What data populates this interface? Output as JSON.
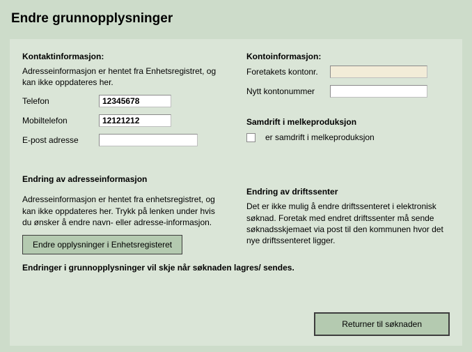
{
  "page": {
    "title": "Endre grunnopplysninger"
  },
  "contact": {
    "header": "Kontaktinformasjon:",
    "help": "Adresseinformasjon er hentet fra Enhetsregistret, og kan ikke oppdateres her.",
    "phone_label": "Telefon",
    "phone_value": "12345678",
    "mobile_label": "Mobiltelefon",
    "mobile_value": "12121212",
    "email_label": "E-post adresse",
    "email_value": ""
  },
  "account": {
    "header": "Kontoinformasjon:",
    "account_label": "Foretakets kontonr.",
    "account_value": "",
    "new_account_label": "Nytt kontonummer",
    "new_account_value": ""
  },
  "samdrift": {
    "header": "Samdrift i melkeproduksjon",
    "checkbox_label": "er samdrift i melkeproduksjon"
  },
  "address_change": {
    "header": "Endring av adresseinformasjon",
    "help": "Adresseinformasjon er hentet fra enhetsregistret, og kan ikke oppdateres her. Trykk på lenken under hvis du ønsker å endre navn- eller adresse-informasjon.",
    "button": "Endre opplysninger i Enhetsregisteret"
  },
  "drift_change": {
    "header": "Endring av driftssenter",
    "help": "Det er ikke mulig å endre driftssenteret i elektronisk søknad. Foretak med endret driftssenter må sende søknadsskjemaet via post til den kommunen hvor det nye driftssenteret ligger."
  },
  "notice": "Endringer i grunnopplysninger vil skje når søknaden lagres/ sendes.",
  "return_button": "Returner til søknaden"
}
